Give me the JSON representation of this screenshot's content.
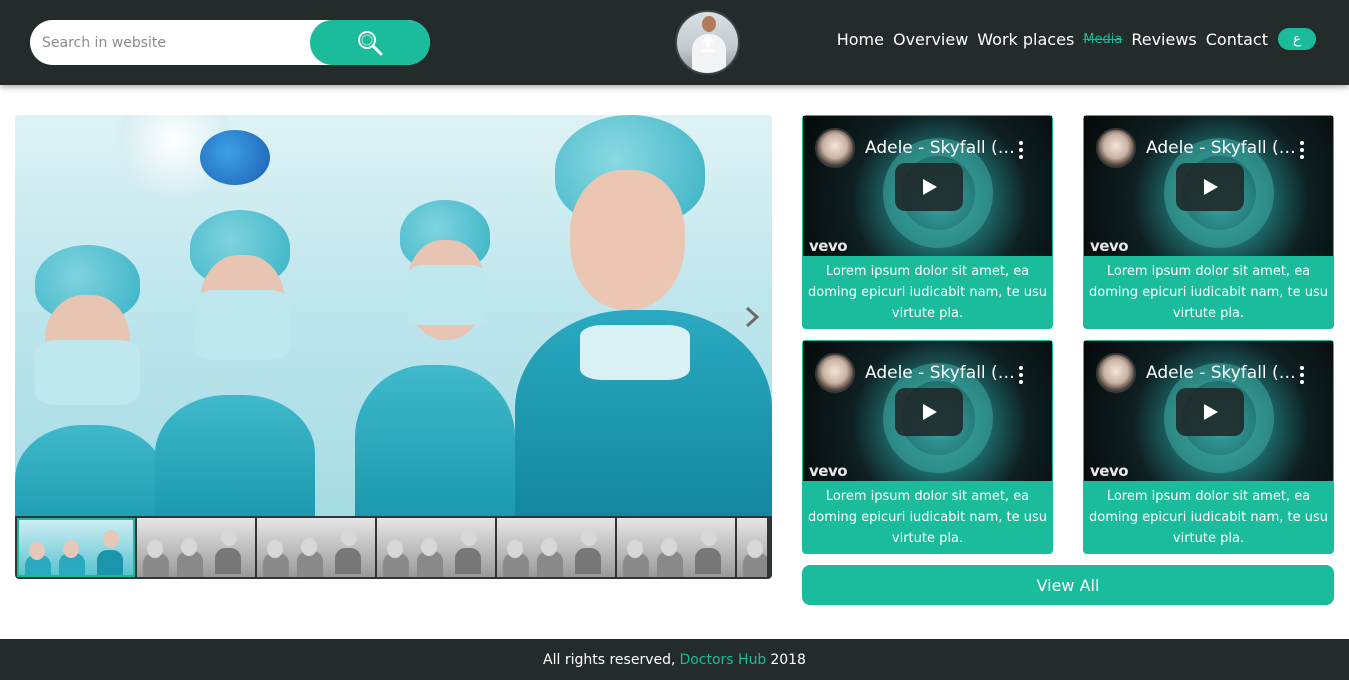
{
  "header": {
    "search": {
      "placeholder": "Search in website",
      "value": "",
      "icon": "search-icon"
    },
    "avatar": {
      "icon": "upload-icon"
    },
    "nav": [
      {
        "label": "Home",
        "active": false
      },
      {
        "label": "Overview",
        "active": false
      },
      {
        "label": "Work places",
        "active": false
      },
      {
        "label": "Media",
        "active": true
      },
      {
        "label": "Reviews",
        "active": false
      },
      {
        "label": "Contact",
        "active": false
      }
    ],
    "language_button": "ع"
  },
  "gallery": {
    "next_icon": "chevron-right-icon",
    "thumbnails_count": 7,
    "active_thumbnail": 1
  },
  "videos": [
    {
      "title": "Adele - Skyfall (Lyric Video)",
      "channel_badge": "vevo",
      "description": "Lorem ipsum dolor sit amet, ea doming epicuri iudicabit nam, te usu virtute pla."
    },
    {
      "title": "Adele - Skyfall (Lyric Video)",
      "channel_badge": "vevo",
      "description": "Lorem ipsum dolor sit amet, ea doming epicuri iudicabit nam, te usu virtute pla."
    },
    {
      "title": "Adele - Skyfall (Lyric Video)",
      "channel_badge": "vevo",
      "description": "Lorem ipsum dolor sit amet, ea doming epicuri iudicabit nam, te usu virtute pla."
    },
    {
      "title": "Adele - Skyfall (Lyric Video)",
      "channel_badge": "vevo",
      "description": "Lorem ipsum dolor sit amet, ea doming epicuri iudicabit nam, te usu virtute pla."
    }
  ],
  "view_all_label": "View All",
  "footer": {
    "prefix": "All rights reserved,",
    "brand": "Doctors Hub",
    "year": "2018"
  },
  "colors": {
    "accent": "#1abc9c",
    "header_bg": "#232b2b",
    "footer_bg": "#232b2b"
  }
}
